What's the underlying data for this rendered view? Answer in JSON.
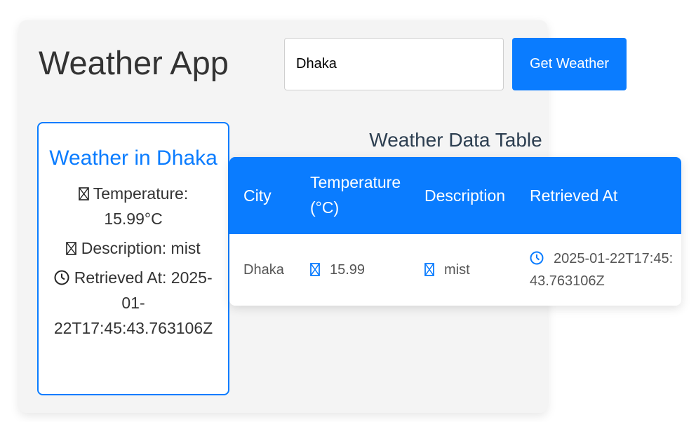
{
  "app": {
    "title": "Weather App"
  },
  "search": {
    "value": "Dhaka",
    "button_label": "Get Weather"
  },
  "card": {
    "heading": "Weather in Dhaka",
    "temperature": "Temperature: 15.99°C",
    "description": "Description: mist",
    "retrieved": "Retrieved At: 2025-01-22T17:45:43.763106Z",
    "icons": [
      "thermometer-icon",
      "cloud-icon",
      "clock-icon"
    ]
  },
  "table": {
    "title": "Weather Data Table",
    "headers": [
      "City",
      "Temperature (°C)",
      "Description",
      "Retrieved At"
    ],
    "rows": [
      {
        "city": "Dhaka",
        "temperature": "15.99",
        "description": "mist",
        "retrieved": "2025-01-22T17:45:43.763106Z"
      }
    ]
  },
  "colors": {
    "accent": "#0a7cff",
    "panel_bg": "#f4f4f4",
    "text": "#333333"
  }
}
